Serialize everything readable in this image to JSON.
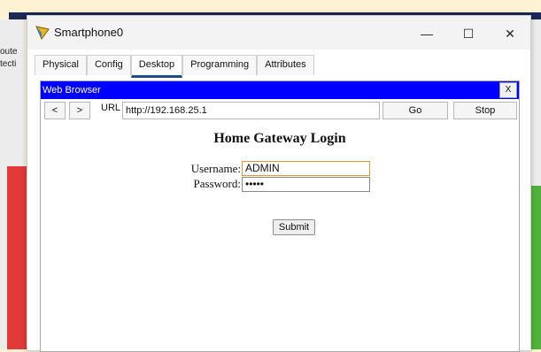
{
  "window": {
    "title": "Smartphone0",
    "controls": {
      "minimize": "—",
      "maximize": "☐",
      "close": "✕"
    }
  },
  "tabs": [
    {
      "label": "Physical",
      "active": false
    },
    {
      "label": "Config",
      "active": false
    },
    {
      "label": "Desktop",
      "active": true
    },
    {
      "label": "Programming",
      "active": false
    },
    {
      "label": "Attributes",
      "active": false
    }
  ],
  "browser": {
    "header": "Web Browser",
    "close": "X",
    "back": "<",
    "forward": ">",
    "url_label": "URL",
    "url": "http://192.168.25.1",
    "go": "Go",
    "stop": "Stop"
  },
  "page": {
    "title": "Home Gateway Login",
    "username_label": "Username:",
    "username_value": "ADMIN",
    "password_label": "Password:",
    "password_value": "•••••",
    "submit": "Submit"
  },
  "background": {
    "left_labels": [
      "oute",
      "tecti"
    ]
  }
}
